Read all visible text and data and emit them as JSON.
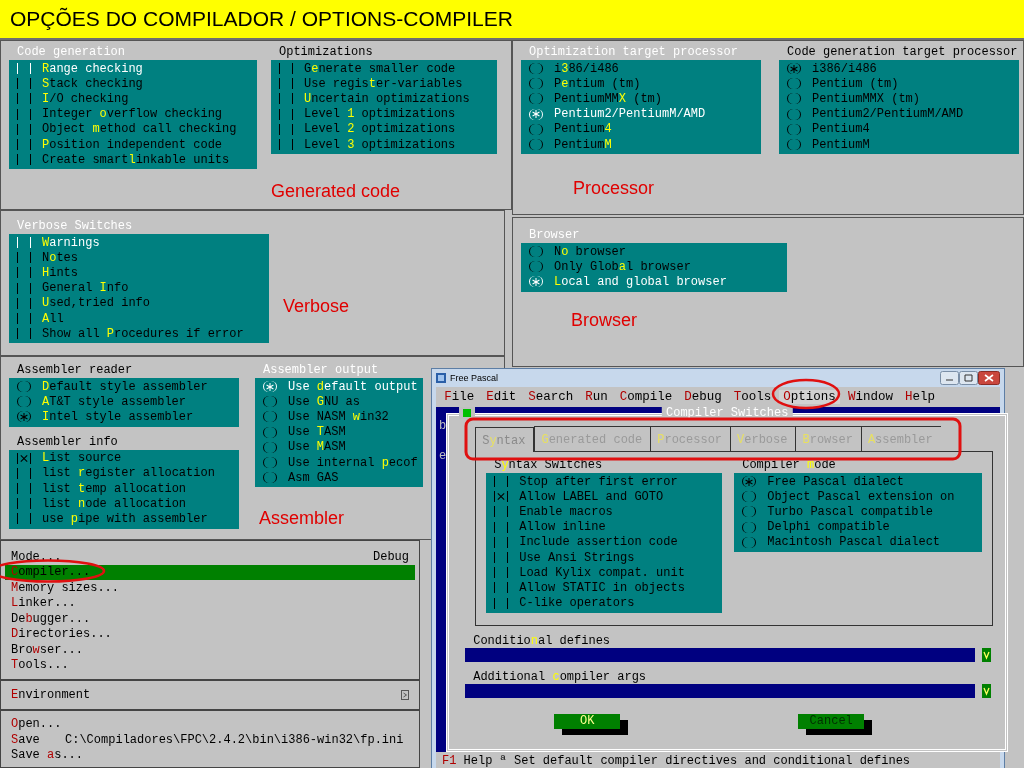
{
  "slide_title": "OPÇÕES DO COMPILADOR / OPTIONS-COMPILER",
  "generated_code": {
    "caption": "Generated code",
    "groups": [
      {
        "title": "Code generation",
        "active": true,
        "kind": "check",
        "items": [
          {
            "label": "**R**ange checking",
            "checked": false,
            "focused": true
          },
          {
            "label": "**S**tack checking",
            "checked": false,
            "focused": false
          },
          {
            "label": "**I**/O checking",
            "checked": false,
            "focused": false
          },
          {
            "label": "Integer **o**verflow checking",
            "checked": false,
            "focused": false
          },
          {
            "label": "Object **m**ethod call checking",
            "checked": false,
            "focused": false
          },
          {
            "label": "**P**osition independent code",
            "checked": false,
            "focused": false
          },
          {
            "label": "Create smart**l**inkable units",
            "checked": false,
            "focused": false
          }
        ]
      },
      {
        "title": "Optimizations",
        "active": false,
        "kind": "check",
        "items": [
          {
            "label": "G**e**nerate smaller code",
            "checked": false,
            "focused": false
          },
          {
            "label": "Use regis**t**er-variables",
            "checked": false,
            "focused": false
          },
          {
            "label": "**U**ncertain optimizations",
            "checked": false,
            "focused": false
          },
          {
            "label": "Level **1** optimizations",
            "checked": false,
            "focused": false
          },
          {
            "label": "Level **2** optimizations",
            "checked": false,
            "focused": false
          },
          {
            "label": "Level **3** optimizations",
            "checked": false,
            "focused": false
          }
        ]
      }
    ]
  },
  "processor": {
    "caption": "Processor",
    "groups": [
      {
        "title": "Optimization target processor",
        "active": true,
        "kind": "radio",
        "items": [
          {
            "label": "i**3**86/i486",
            "selected": false,
            "focused": false
          },
          {
            "label": "P**e**ntium (tm)",
            "selected": false,
            "focused": false
          },
          {
            "label": "PentiumMM**X** (tm)",
            "selected": false,
            "focused": false
          },
          {
            "label": "Pentium2/PentiumM/AMD",
            "selected": true,
            "focused": true
          },
          {
            "label": "Pentium**4**",
            "selected": false,
            "focused": false
          },
          {
            "label": "Pentium**M**",
            "selected": false,
            "focused": false
          }
        ]
      },
      {
        "title": "Code generation target processor",
        "active": false,
        "kind": "radio",
        "items": [
          {
            "label": "i386/i486",
            "selected": true,
            "focused": false
          },
          {
            "label": "Pentium (tm)",
            "selected": false,
            "focused": false
          },
          {
            "label": "PentiumMMX (tm)",
            "selected": false,
            "focused": false
          },
          {
            "label": "Pentium2/PentiumM/AMD",
            "selected": false,
            "focused": false
          },
          {
            "label": "Pentium4",
            "selected": false,
            "focused": false
          },
          {
            "label": "PentiumM",
            "selected": false,
            "focused": false
          }
        ]
      }
    ]
  },
  "browser": {
    "caption": "Browser",
    "groups": [
      {
        "title": "Browser",
        "active": true,
        "kind": "radio",
        "items": [
          {
            "label": "N**o** browser",
            "selected": false,
            "focused": false
          },
          {
            "label": "Only Glob**a**l browser",
            "selected": false,
            "focused": false
          },
          {
            "label": "**L**ocal and global browser",
            "selected": true,
            "focused": true
          }
        ]
      }
    ]
  },
  "verbose": {
    "caption": "Verbose",
    "groups": [
      {
        "title": "Verbose Switches",
        "active": true,
        "kind": "check",
        "items": [
          {
            "label": "**W**arnings",
            "checked": false,
            "focused": true
          },
          {
            "label": "N**o**tes",
            "checked": false,
            "focused": false
          },
          {
            "label": "**H**ints",
            "checked": false,
            "focused": false
          },
          {
            "label": "General **I**nfo",
            "checked": false,
            "focused": false
          },
          {
            "label": "**U**sed,tried info",
            "checked": false,
            "focused": false
          },
          {
            "label": "**A**ll",
            "checked": false,
            "focused": false
          },
          {
            "label": "Show all **P**rocedures if error",
            "checked": false,
            "focused": false
          }
        ]
      }
    ]
  },
  "assembler": {
    "caption": "Assembler",
    "groups": [
      {
        "title": "Assembler reader",
        "active": false,
        "kind": "radio",
        "items": [
          {
            "label": "**D**efault style assembler",
            "selected": false,
            "focused": false
          },
          {
            "label": "**A**T&T style assembler",
            "selected": false,
            "focused": false
          },
          {
            "label": "**I**ntel style assembler",
            "selected": true,
            "focused": false
          }
        ]
      },
      {
        "title": "Assembler info",
        "active": false,
        "kind": "check",
        "items": [
          {
            "label": "**L**ist source",
            "checked": true,
            "focused": false
          },
          {
            "label": "list **r**egister allocation",
            "checked": false,
            "focused": false
          },
          {
            "label": "list **t**emp allocation",
            "checked": false,
            "focused": false
          },
          {
            "label": "list **n**ode allocation",
            "checked": false,
            "focused": false
          },
          {
            "label": "use **p**ipe with assembler",
            "checked": false,
            "focused": false
          }
        ]
      },
      {
        "title": "Assembler output",
        "active": true,
        "kind": "radio",
        "items": [
          {
            "label": "Use **d**efault output",
            "selected": true,
            "focused": true
          },
          {
            "label": "Use **G**NU as",
            "selected": false,
            "focused": false
          },
          {
            "label": "Use NASM **w**in32",
            "selected": false,
            "focused": false
          },
          {
            "label": "Use **T**ASM",
            "selected": false,
            "focused": false
          },
          {
            "label": "Use **M**ASM",
            "selected": false,
            "focused": false
          },
          {
            "label": "Use internal **p**ecof",
            "selected": false,
            "focused": false
          },
          {
            "label": "Asm GAS",
            "selected": false,
            "focused": false
          }
        ]
      }
    ]
  },
  "options_menu": {
    "sections": [
      {
        "items": [
          {
            "label": "Mode...",
            "detail": "Debug",
            "selected": false,
            "submenu": false
          },
          {
            "label": "**C**ompiler...",
            "selected": true,
            "submenu": false
          },
          {
            "label": "**M**emory sizes...",
            "selected": false,
            "submenu": false
          },
          {
            "label": "**L**inker...",
            "selected": false,
            "submenu": false
          },
          {
            "label": "De**b**ugger...",
            "selected": false,
            "submenu": false
          },
          {
            "label": "**D**irectories...",
            "selected": false,
            "submenu": false
          },
          {
            "label": "Bro**w**ser...",
            "selected": false,
            "submenu": false
          },
          {
            "label": "**T**ools...",
            "selected": false,
            "submenu": false
          }
        ]
      },
      {
        "items": [
          {
            "label": "**E**nvironment",
            "selected": false,
            "submenu": true
          }
        ]
      },
      {
        "items": [
          {
            "label": "**O**pen...",
            "selected": false,
            "submenu": false
          },
          {
            "label": "**S**ave",
            "detail": "C:\\Compiladores\\FPC\\2.4.2\\bin\\i386-win32\\fp.ini",
            "selected": false,
            "submenu": false
          },
          {
            "label": "Save **a**s...",
            "selected": false,
            "submenu": false
          }
        ]
      }
    ]
  },
  "ide_window": {
    "title": "Free Pascal",
    "menu": [
      {
        "label": "**F**ile",
        "selected": false
      },
      {
        "label": "**E**dit",
        "selected": false
      },
      {
        "label": "**S**earch",
        "selected": false
      },
      {
        "label": "**R**un",
        "selected": false
      },
      {
        "label": "**C**ompile",
        "selected": false
      },
      {
        "label": "**D**ebug",
        "selected": false
      },
      {
        "label": "**T**ools",
        "selected": false
      },
      {
        "label": "**O**ptions",
        "selected": true
      },
      {
        "label": "**W**indow",
        "selected": false
      },
      {
        "label": "**H**elp",
        "selected": false
      }
    ],
    "editor_text": [
      "b",
      "e"
    ],
    "dialog": {
      "title": "Compiler Switches",
      "tabs": [
        {
          "label": "S**y**ntax",
          "selected": true
        },
        {
          "label": "**G**enerated code",
          "selected": false
        },
        {
          "label": "**P**rocessor",
          "selected": false
        },
        {
          "label": "**V**erbose",
          "selected": false
        },
        {
          "label": "**B**rowser",
          "selected": false
        },
        {
          "label": "**A**ssembler",
          "selected": false
        }
      ],
      "groups": [
        {
          "title": "S**y**ntax Switches",
          "active": false,
          "kind": "check",
          "items": [
            {
              "label": "Stop after first error",
              "checked": false,
              "focused": false
            },
            {
              "label": "Allow LABEL and GOTO",
              "checked": true,
              "focused": false
            },
            {
              "label": "Enable macros",
              "checked": false,
              "focused": false
            },
            {
              "label": "Allow inline",
              "checked": false,
              "focused": false
            },
            {
              "label": "Include assertion code",
              "checked": false,
              "focused": false
            },
            {
              "label": "Use Ansi Strings",
              "checked": false,
              "focused": false
            },
            {
              "label": "Load Kylix compat. unit",
              "checked": false,
              "focused": false
            },
            {
              "label": "Allow STATIC in objects",
              "checked": false,
              "focused": false
            },
            {
              "label": "C-like operators",
              "checked": false,
              "focused": false
            }
          ]
        },
        {
          "title": "Compiler **m**ode",
          "active": false,
          "kind": "radio",
          "items": [
            {
              "label": "Free Pascal dialect",
              "selected": true,
              "focused": false
            },
            {
              "label": "Object Pascal extension on",
              "selected": false,
              "focused": false
            },
            {
              "label": "Turbo Pascal compatible",
              "selected": false,
              "focused": false
            },
            {
              "label": "Delphi compatible",
              "selected": false,
              "focused": false
            },
            {
              "label": "Macintosh Pascal dialect",
              "selected": false,
              "focused": false
            }
          ]
        }
      ],
      "fields": [
        {
          "label": "Conditio**n**al defines"
        },
        {
          "label": "Additional **c**ompiler args"
        }
      ],
      "buttons": [
        {
          "label": "OK",
          "focused": true
        },
        {
          "label": "Cancel",
          "focused": false
        }
      ]
    },
    "status": {
      "key": "F1",
      "text": "Help ª Set default compiler directives and conditional defines"
    }
  }
}
